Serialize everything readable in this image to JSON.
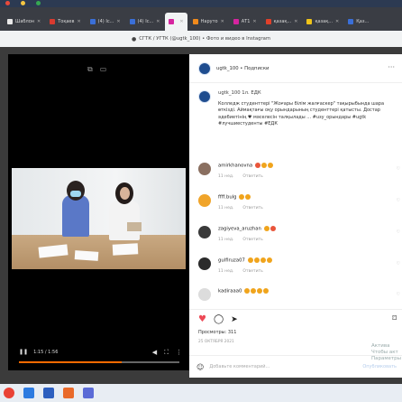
{
  "browser": {
    "tabs": [
      {
        "label": "Шаблон"
      },
      {
        "label": "Тоқаев"
      },
      {
        "label": "(4) Іс..."
      },
      {
        "label": "(4) Іс..."
      },
      {
        "label": ""
      },
      {
        "label": "Наруто"
      },
      {
        "label": "АТ1"
      },
      {
        "label": "қазақ..."
      },
      {
        "label": "қазақ..."
      },
      {
        "label": "Қаз..."
      }
    ],
    "address": "СГТК / УГТК (@ugtk_100) • Фото и видео в Instagram"
  },
  "video": {
    "time": "1:15 / 1:56",
    "progress_percent": 64
  },
  "post": {
    "header_user": "ugtk_100 • Подписки",
    "caption_user": "ugtk_100 1л. ЕДК",
    "caption_text": "Колледж студенттері \"Жоғары білім жалғаскер\" тақырыбында шара өткізді. Аймақтағы оқу орындарының студенттері қатысты. Достар әдебиетінің ♥ мәселесін талқылады ... #uзу_орындары #ugtk #лучшиестуденты #ЕДК",
    "comments": [
      {
        "user": "amirkhanovna",
        "emojis": 3,
        "time": "11 нед.",
        "reply": "Ответить"
      },
      {
        "user": "ffff.bulg",
        "emojis": 2,
        "time": "11 нед.",
        "reply": "Ответить"
      },
      {
        "user": "zagiyeva_aruzhan",
        "emojis": 2,
        "time": "11 нед.",
        "reply": "Ответить"
      },
      {
        "user": "gulfiruza07",
        "emojis": 4,
        "time": "11 нед.",
        "reply": "Ответить"
      },
      {
        "user": "kadiraaa0",
        "emojis": 4,
        "time": "11 нед.",
        "reply": "Ответить"
      }
    ],
    "views": "Просмотры: 311",
    "date": "25 ОКТЯБРЯ 2021",
    "add_comment_placeholder": "Добавьте комментарий...",
    "publish_label": "Опубликовать"
  },
  "watermark": {
    "line1": "Актива",
    "line2": "Чтобы акт",
    "line3": "Параметры"
  },
  "colors": {
    "accent_orange": "#ff6a00",
    "ig_link": "#0095f6",
    "like_red": "#ed4956"
  }
}
